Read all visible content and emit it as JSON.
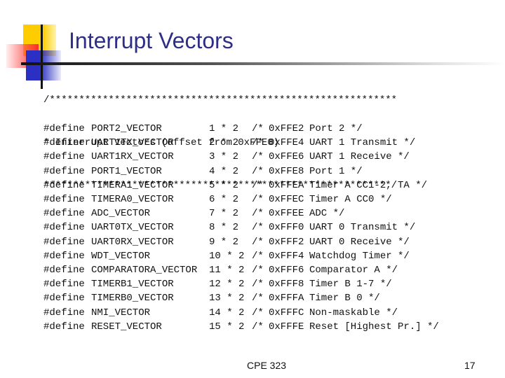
{
  "title": "Interrupt Vectors",
  "header_comment": [
    "/***********************************************************",
    "* Interrupt Vectors (offset from 0xFFE0)",
    "***********************************************************/"
  ],
  "keyword": "#define",
  "vectors": [
    {
      "name": "PORT2_VECTOR",
      "value": "1 * 2",
      "open": "/*",
      "addr": "0xFFE2",
      "desc": "Port 2 */"
    },
    {
      "name": "UART1TX_VECTOR",
      "value": "2 * 2",
      "open": "/*",
      "addr": "0xFFE4",
      "desc": "UART 1 Transmit */"
    },
    {
      "name": "UART1RX_VECTOR",
      "value": "3 * 2",
      "open": "/*",
      "addr": "0xFFE6",
      "desc": "UART 1 Receive */"
    },
    {
      "name": "PORT1_VECTOR",
      "value": "4 * 2",
      "open": "/*",
      "addr": "0xFFE8",
      "desc": "Port 1 */"
    },
    {
      "name": "TIMERA1_VECTOR",
      "value": "5 * 2",
      "open": "/*",
      "addr": "0xFFEA",
      "desc": "Timer A CC1-2, TA */"
    },
    {
      "name": "TIMERA0_VECTOR",
      "value": "6 * 2",
      "open": "/*",
      "addr": "0xFFEC",
      "desc": "Timer A CC0 */"
    },
    {
      "name": "ADC_VECTOR",
      "value": "7 * 2",
      "open": "/*",
      "addr": "0xFFEE",
      "desc": "ADC */"
    },
    {
      "name": "UART0TX_VECTOR",
      "value": "8 * 2",
      "open": "/*",
      "addr": "0xFFF0",
      "desc": "UART 0 Transmit */"
    },
    {
      "name": "UART0RX_VECTOR",
      "value": "9 * 2",
      "open": "/*",
      "addr": "0xFFF2",
      "desc": "UART 0 Receive */"
    },
    {
      "name": "WDT_VECTOR",
      "value": "10 * 2",
      "open": "/*",
      "addr": "0xFFF4",
      "desc": "Watchdog Timer */"
    },
    {
      "name": "COMPARATORA_VECTOR",
      "value": "11 * 2",
      "open": "/*",
      "addr": "0xFFF6",
      "desc": "Comparator A */"
    },
    {
      "name": "TIMERB1_VECTOR",
      "value": "12 * 2",
      "open": "/*",
      "addr": "0xFFF8",
      "desc": "Timer B 1-7 */"
    },
    {
      "name": "TIMERB0_VECTOR",
      "value": "13 * 2",
      "open": "/*",
      "addr": "0xFFFA",
      "desc": "Timer B 0 */"
    },
    {
      "name": "NMI_VECTOR",
      "value": "14 * 2",
      "open": "/*",
      "addr": "0xFFFC",
      "desc": "Non-maskable */"
    },
    {
      "name": "RESET_VECTOR",
      "value": "15 * 2",
      "open": "/*",
      "addr": "0xFFFE",
      "desc": "Reset [Highest Pr.] */"
    }
  ],
  "footer": {
    "course": "CPE 323",
    "page": "17"
  }
}
